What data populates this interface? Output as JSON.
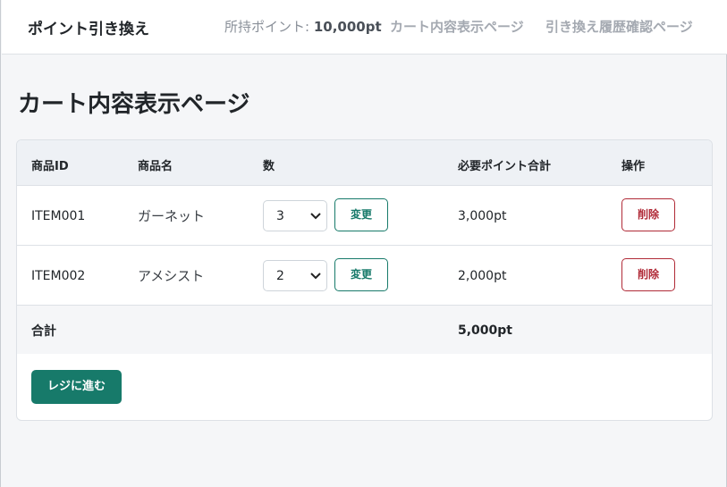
{
  "navbar": {
    "brand": "ポイント引き換え",
    "points_label": "所持ポイント: ",
    "points_value": "10,000pt",
    "links": [
      "カート内容表示ページ",
      "引き換え履歴確認ページ"
    ]
  },
  "page": {
    "title": "カート内容表示ページ"
  },
  "table": {
    "headers": [
      "商品ID",
      "商品名",
      "数",
      "必要ポイント合計",
      "操作"
    ],
    "rows": [
      {
        "id": "ITEM001",
        "name": "ガーネット",
        "qty": "3",
        "change_label": "変更",
        "points": "3,000pt",
        "delete_label": "削除"
      },
      {
        "id": "ITEM002",
        "name": "アメシスト",
        "qty": "2",
        "change_label": "変更",
        "points": "2,000pt",
        "delete_label": "削除"
      }
    ],
    "total_label": "合計",
    "total_value": "5,000pt"
  },
  "checkout_label": "レジに進む",
  "colors": {
    "primary": "#177a6a",
    "danger": "#b02a37",
    "header_bg": "#eef1f5",
    "page_bg": "#f5f6f8"
  },
  "icons": {
    "select": "chevron-down-icon"
  }
}
